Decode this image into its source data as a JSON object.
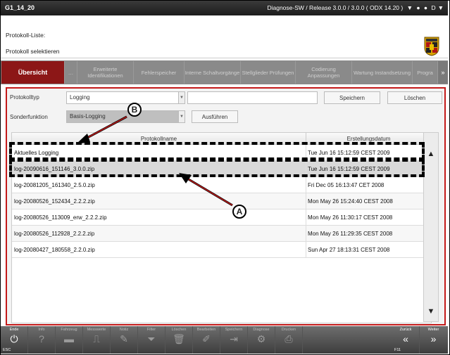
{
  "titlebar": {
    "left": "G1_14_20",
    "right": "Diagnose-SW / Release 3.0.0 / 3.0.0  ( ODX  14.20 )",
    "icons": [
      "funnel-icon",
      "dot-icon",
      "dot-icon"
    ],
    "right_code": "D",
    "right_arrow": "▼"
  },
  "header": {
    "line1": "Protokoll-Liste:",
    "line2": "Protokoll selektieren"
  },
  "tabs": [
    {
      "label": "Übersicht",
      "active": true
    },
    {
      "label": "…",
      "active": false
    },
    {
      "label": "Erweiterte Identifikationen",
      "active": false
    },
    {
      "label": "Fehlerspeicher",
      "active": false
    },
    {
      "label": "Interne Schaltvorgänge",
      "active": false
    },
    {
      "label": "Stellglieder Prüfungen",
      "active": false
    },
    {
      "label": "Codierung Anpassungen",
      "active": false
    },
    {
      "label": "Wartung Instandsetzung",
      "active": false
    },
    {
      "label": "Progra",
      "active": false
    }
  ],
  "tab_more": "»",
  "form": {
    "protokolltyp_label": "Protokolltyp",
    "protokolltyp_value": "Logging",
    "speichern": "Speichern",
    "loeschen": "Löschen",
    "sonderfunktion_label": "Sonderfunktion",
    "sonderfunktion_value": "Basis-Logging",
    "ausfuehren": "Ausführen"
  },
  "table": {
    "headers": [
      "Protokollname",
      "Erstellungsdatum"
    ],
    "rows": [
      {
        "name": "Aktuelles Logging",
        "date": "Tue Jun 16 15:12:59 CEST 2009"
      },
      {
        "name": "log-20090616_151146_3.0.0.zip",
        "date": "Tue Jun 16 15:12:59 CEST 2009"
      },
      {
        "name": "log-20081205_161340_2.5.0.zip",
        "date": "Fri Dec 05 16:13:47 CET 2008"
      },
      {
        "name": "log-20080526_152434_2.2.2.zip",
        "date": "Mon May 26 15:24:40 CEST 2008"
      },
      {
        "name": "log-20080526_113009_erw_2.2.2.zip",
        "date": "Mon May 26 11:30:17 CEST 2008"
      },
      {
        "name": "log-20080526_112928_2.2.2.zip",
        "date": "Mon May 26 11:29:35 CEST 2008"
      },
      {
        "name": "log-20080427_180558_2.2.0.zip",
        "date": "Sun Apr 27 18:13:31 CEST 2008"
      }
    ],
    "scroll_up": "▲",
    "scroll_down": "▼"
  },
  "annotations": {
    "a": "A",
    "b": "B"
  },
  "footer": [
    {
      "label": "Ende",
      "icon": "⏻",
      "fn": "ESC",
      "on": true
    },
    {
      "label": "Info",
      "icon": "?",
      "fn": "",
      "on": false
    },
    {
      "label": "Fahrzeug",
      "icon": "▬",
      "fn": "",
      "on": false
    },
    {
      "label": "Messwerte",
      "icon": "⎍",
      "fn": "",
      "on": false
    },
    {
      "label": "Notiz",
      "icon": "✎",
      "fn": "",
      "on": false
    },
    {
      "label": "Filter",
      "icon": "⏷",
      "fn": "",
      "on": false
    },
    {
      "label": "Löschen",
      "icon": "🗑",
      "fn": "",
      "on": false
    },
    {
      "label": "Bearbeiten",
      "icon": "✐",
      "fn": "",
      "on": false
    },
    {
      "label": "Speichern",
      "icon": "⇥",
      "fn": "",
      "on": false
    },
    {
      "label": "Diagnose",
      "icon": "⚙",
      "fn": "",
      "on": false
    },
    {
      "label": "Drucken",
      "icon": "⎙",
      "fn": "",
      "on": false
    },
    {
      "label": "Zurück",
      "icon": "«",
      "fn": "F11",
      "on": true
    },
    {
      "label": "Weiter",
      "icon": "»",
      "fn": "",
      "on": true
    }
  ]
}
